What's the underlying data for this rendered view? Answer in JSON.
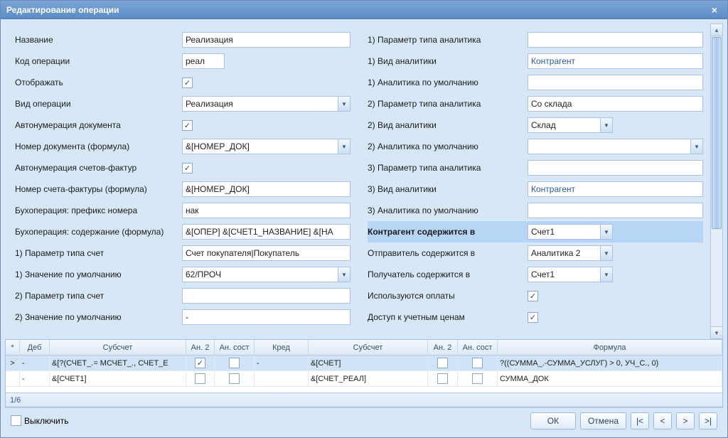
{
  "title": "Редактирование операции",
  "left": {
    "r0": {
      "label": "Название",
      "value": "Реализация"
    },
    "r1": {
      "label": "Код операции",
      "value": "реал"
    },
    "r2": {
      "label": "Отображать",
      "checked": true
    },
    "r3": {
      "label": "Вид операции",
      "value": "Реализация"
    },
    "r4": {
      "label": "Автонумерация документа",
      "checked": true
    },
    "r5": {
      "label": "Номер документа (формула)",
      "value": "&[НОМЕР_ДОК]"
    },
    "r6": {
      "label": "Автонумерация счетов-фактур",
      "checked": true
    },
    "r7": {
      "label": "Номер счета-фактуры (формула)",
      "value": "&[НОМЕР_ДОК]"
    },
    "r8": {
      "label": "Бухоперация: префикс номера",
      "value": "нак"
    },
    "r9": {
      "label": "Бухоперация: содержание (формула)",
      "value": "&[ОПЕР] &[СЧЕТ1_НАЗВАНИЕ] &[НА"
    },
    "r10": {
      "label": "1) Параметр типа счет",
      "value": "Счет покупателя|Покупатель"
    },
    "r11": {
      "label": "1) Значение по умолчанию",
      "value": "62/ПРОЧ"
    },
    "r12": {
      "label": "2) Параметр типа счет",
      "value": ""
    },
    "r13": {
      "label": "2) Значение по умолчанию",
      "value": "-"
    }
  },
  "right": {
    "r0": {
      "label": "1) Параметр типа аналитика",
      "value": ""
    },
    "r1": {
      "label": "1) Вид аналитики",
      "value": "Контрагент"
    },
    "r2": {
      "label": "1) Аналитика по умолчанию",
      "value": ""
    },
    "r3": {
      "label": "2) Параметр типа аналитика",
      "value": "Со склада"
    },
    "r4": {
      "label": "2) Вид аналитики",
      "value": "Склад"
    },
    "r5": {
      "label": "2) Аналитика по умолчанию",
      "value": ""
    },
    "r6": {
      "label": "3) Параметр типа аналитика",
      "value": ""
    },
    "r7": {
      "label": "3) Вид аналитики",
      "value": "Контрагент"
    },
    "r8": {
      "label": "3) Аналитика по умолчанию",
      "value": ""
    },
    "r9": {
      "label": "Контрагент содержится в",
      "value": "Счет1"
    },
    "r10": {
      "label": "Отправитель содержится в",
      "value": "Аналитика 2"
    },
    "r11": {
      "label": "Получатель содержится в",
      "value": "Счет1"
    },
    "r12": {
      "label": "Используются оплаты",
      "checked": true
    },
    "r13": {
      "label": "Доступ к учетным ценам",
      "checked": true
    }
  },
  "grid": {
    "headers": {
      "mk": "*",
      "deb": "Деб",
      "sub": "Субсчет",
      "an2": "Ан. 2",
      "ansost": "Ан. сост",
      "kred": "Кред",
      "sub2": "Субсчет",
      "an2b": "Ан. 2",
      "ansostb": "Ан. сост",
      "form": "Формула"
    },
    "rows": [
      {
        "mk": ">",
        "deb": "-",
        "sub": "&[?(СЧЕТ_.= МСЧЕТ_., СЧЕТ_Е",
        "an2": true,
        "ansost": false,
        "kred": "-",
        "sub2": "&[СЧЕТ]",
        "an2b": false,
        "ansostb": false,
        "form": "?((СУММА_.-СУММА_УСЛУГ) > 0, УЧ_С., 0)"
      },
      {
        "mk": "",
        "deb": "-",
        "sub": "&[СЧЕТ1]",
        "an2": false,
        "ansost": false,
        "kred": "",
        "sub2": "&[СЧЕТ_РЕАЛ]",
        "an2b": false,
        "ansostb": false,
        "form": "СУММА_ДОК"
      }
    ],
    "footer": "1/6"
  },
  "footer": {
    "off": "Выключить",
    "ok": "ОК",
    "cancel": "Отмена"
  }
}
